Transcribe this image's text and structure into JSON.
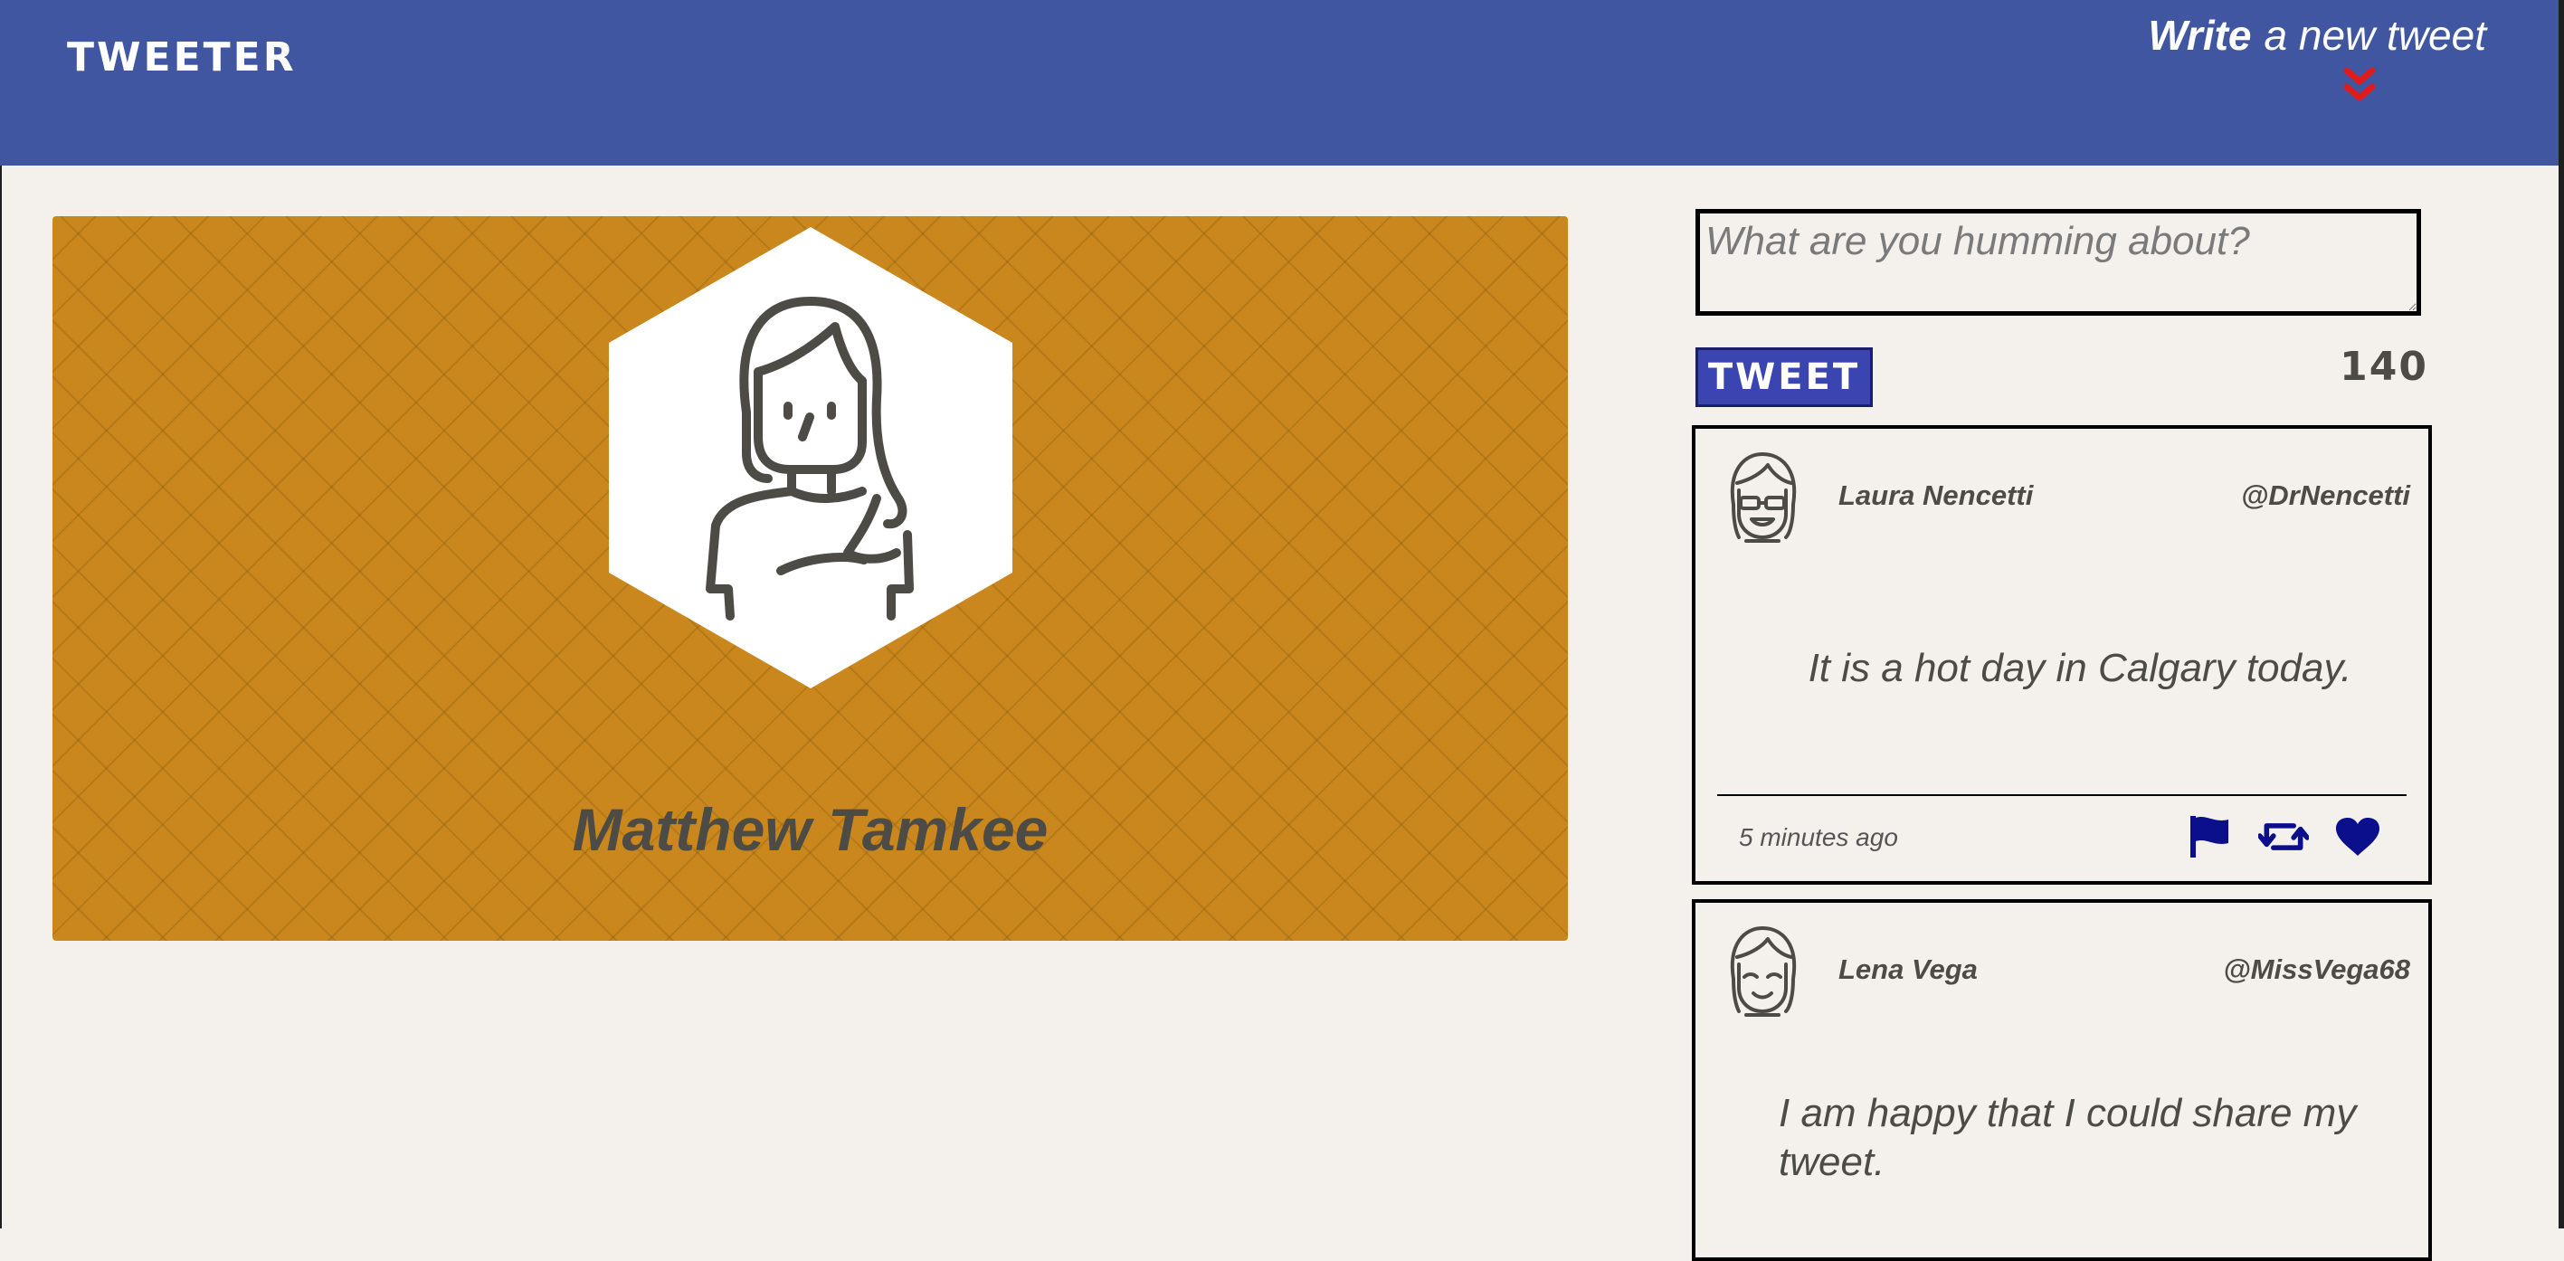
{
  "app": {
    "brand": "TWEETER"
  },
  "nav": {
    "compose_bold": "Write",
    "compose_rest": "a new tweet",
    "compose_icon": "double-chevron-down-icon",
    "chevron_color": "#e01b1b"
  },
  "colors": {
    "nav_bg": "#4056a1",
    "page_bg": "#f4f1ec",
    "profile_bg": "#c9871e",
    "accent_icon": "#0b0f8c",
    "tweet_button_bg": "#3b45b1",
    "text_dark": "#4c4b45"
  },
  "profile": {
    "name": "Matthew Tamkee",
    "avatar_icon": "woman-avatar-icon"
  },
  "composer": {
    "placeholder": "What are you humming about?",
    "value": "",
    "button_label": "TWEET",
    "char_count": "140"
  },
  "tweets": [
    {
      "author": "Laura Nencetti",
      "handle": "@DrNencetti",
      "text": "It is a hot day in Calgary today.",
      "time": "5 minutes ago",
      "avatar_icon": "girl-with-glasses-avatar-icon",
      "actions": [
        "flag-icon",
        "retweet-icon",
        "heart-icon"
      ]
    },
    {
      "author": "Lena Vega",
      "handle": "@MissVega68",
      "text": "I am happy that I could share my tweet.",
      "avatar_icon": "smiling-girl-avatar-icon"
    }
  ]
}
